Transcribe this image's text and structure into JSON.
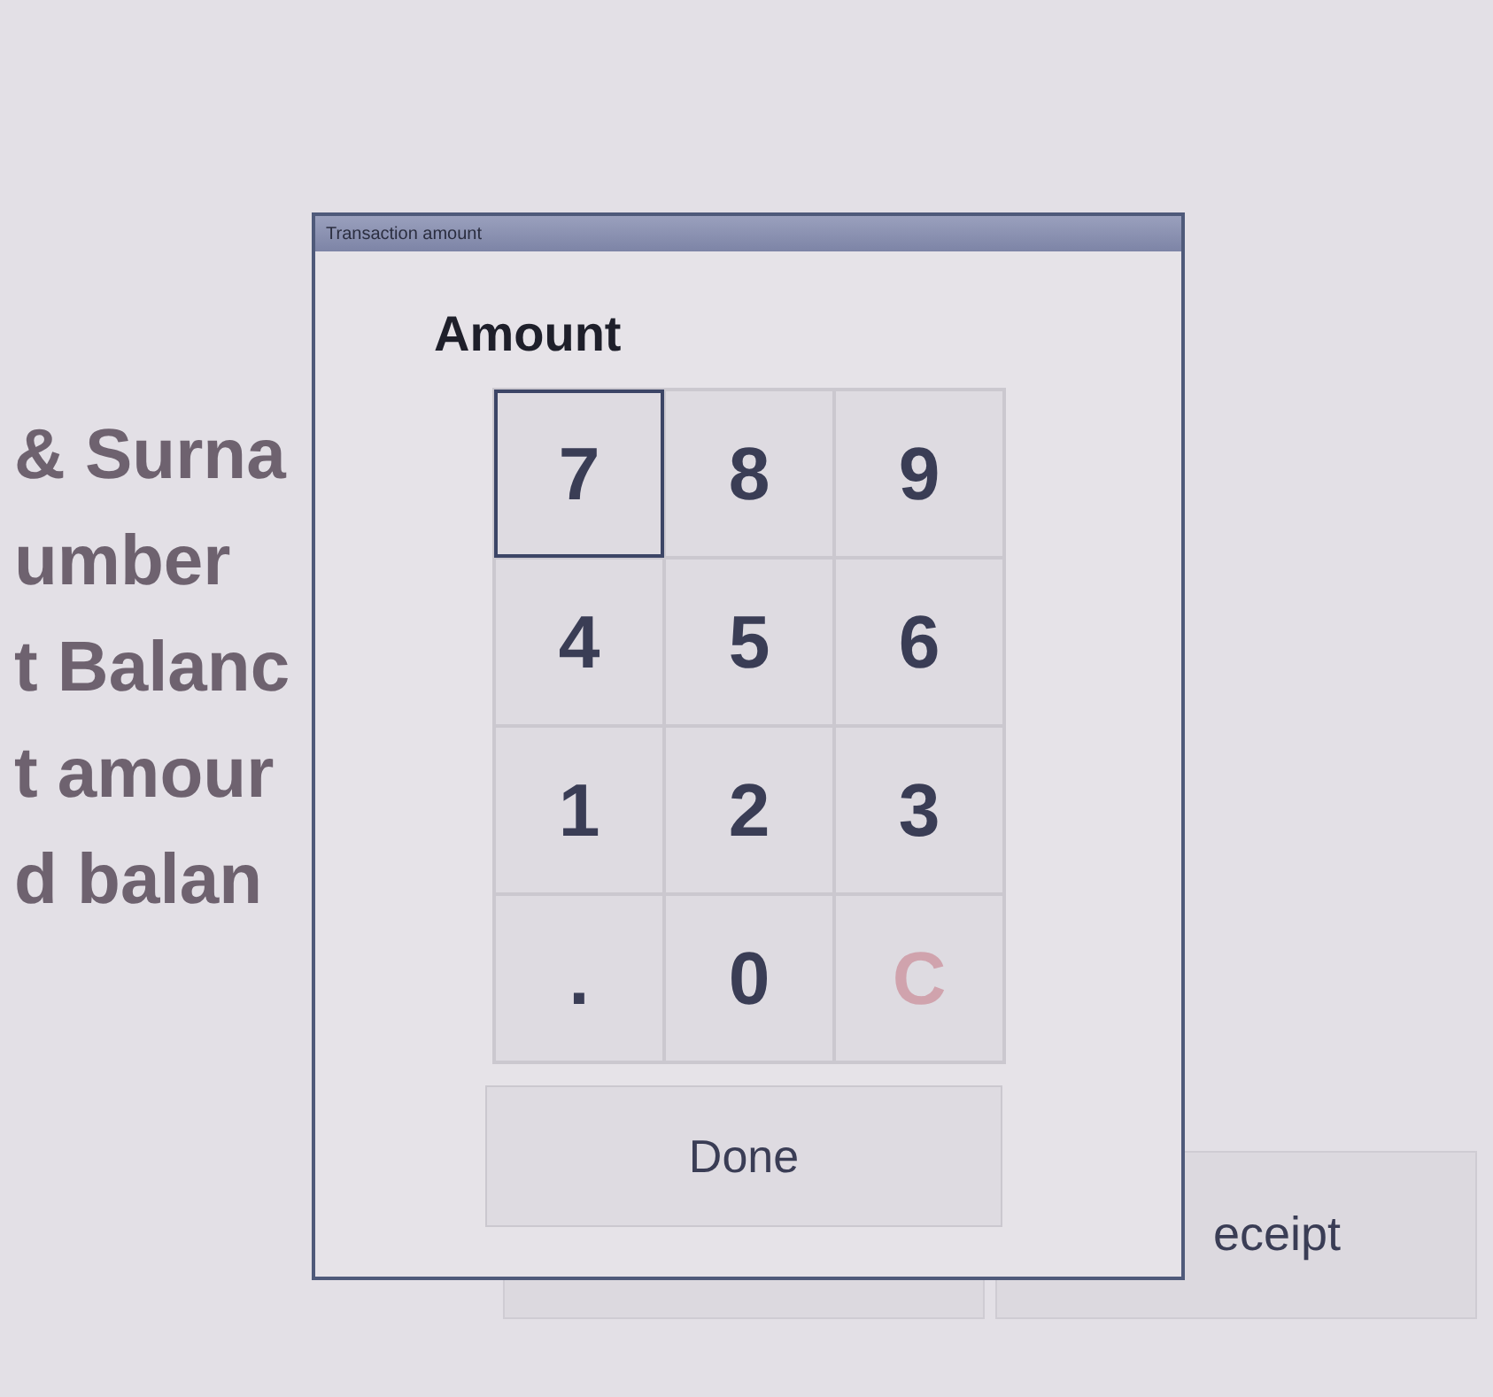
{
  "background": {
    "labels": [
      "& Surna",
      "umber",
      "t Balanc",
      "t amour",
      "d balan"
    ],
    "receipt_button": "eceipt"
  },
  "dialog": {
    "title": "Transaction amount",
    "heading": "Amount",
    "keys": [
      {
        "label": "7",
        "kind": "digit",
        "selected": true
      },
      {
        "label": "8",
        "kind": "digit",
        "selected": false
      },
      {
        "label": "9",
        "kind": "digit",
        "selected": false
      },
      {
        "label": "4",
        "kind": "digit",
        "selected": false
      },
      {
        "label": "5",
        "kind": "digit",
        "selected": false
      },
      {
        "label": "6",
        "kind": "digit",
        "selected": false
      },
      {
        "label": "1",
        "kind": "digit",
        "selected": false
      },
      {
        "label": "2",
        "kind": "digit",
        "selected": false
      },
      {
        "label": "3",
        "kind": "digit",
        "selected": false
      },
      {
        "label": ".",
        "kind": "digit",
        "selected": false
      },
      {
        "label": "0",
        "kind": "digit",
        "selected": false
      },
      {
        "label": "C",
        "kind": "clear",
        "selected": false
      }
    ],
    "done": "Done"
  }
}
